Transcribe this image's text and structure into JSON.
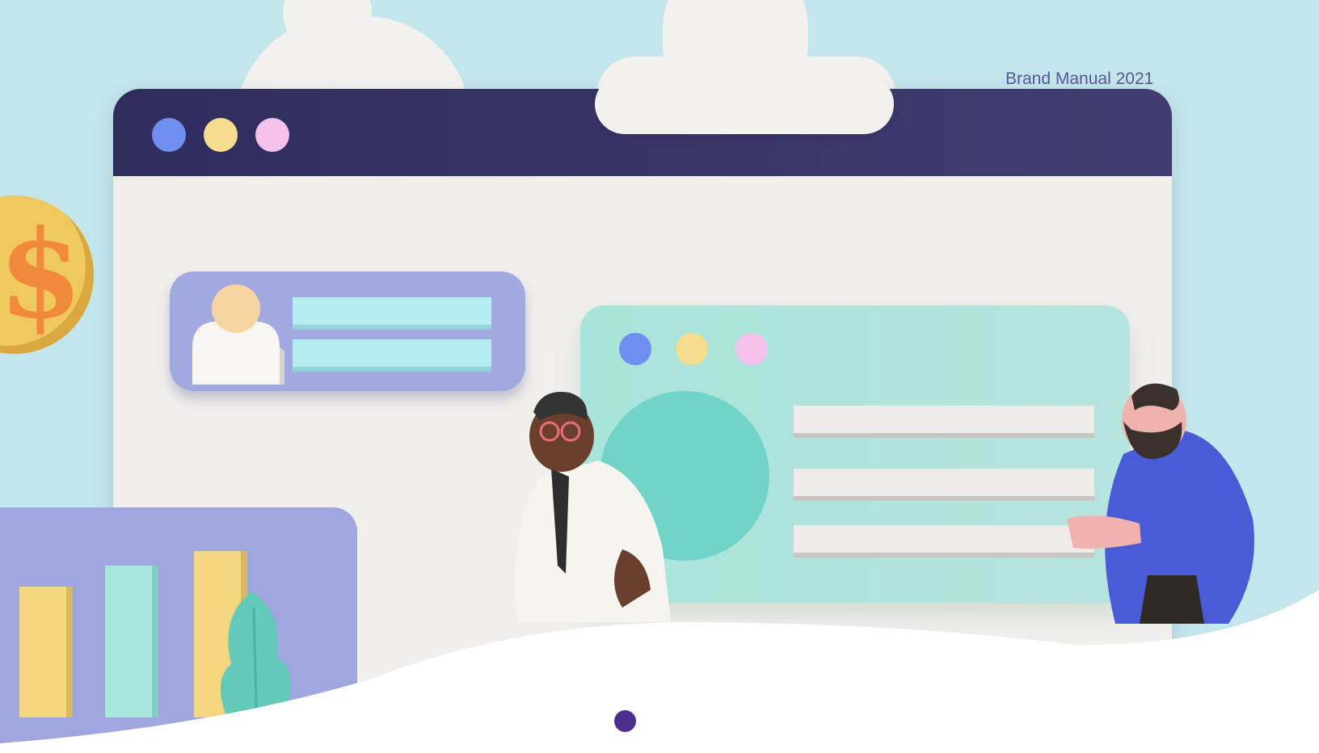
{
  "header": {
    "tagline": "Brand Manual 2021"
  },
  "colors": {
    "sky": "#c3e6ec",
    "browser_bar": "#35325f",
    "browser_body": "#f1efec",
    "dot_blue": "#6f8ff0",
    "dot_yellow": "#f5dc8f",
    "dot_pink": "#f4c1ec",
    "accent_purple": "#4c2f8d",
    "coin": "#efc85e",
    "teal": "#72d4c8"
  },
  "illustration": {
    "coin_symbol": "$",
    "icons": [
      "dollar-coin-icon",
      "user-avatar-icon",
      "bar-chart-icon",
      "plant-icon"
    ]
  },
  "pagination": {
    "current_page_indicator": "active-dot"
  }
}
